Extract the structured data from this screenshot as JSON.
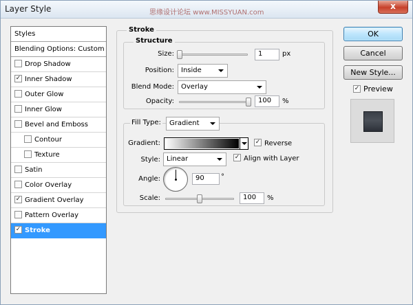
{
  "window": {
    "title": "Layer Style",
    "watermark": "思缘设计论坛 www.MISSYUAN.com",
    "close_glyph": "x"
  },
  "styles_list": {
    "header": "Styles",
    "blending_options": "Blending Options: Custom",
    "items": [
      {
        "label": "Drop Shadow",
        "checked": false,
        "check": ""
      },
      {
        "label": "Inner Shadow",
        "checked": true,
        "check": "✓"
      },
      {
        "label": "Outer Glow",
        "checked": false,
        "check": ""
      },
      {
        "label": "Inner Glow",
        "checked": false,
        "check": ""
      },
      {
        "label": "Bevel and Emboss",
        "checked": false,
        "check": ""
      },
      {
        "label": "Contour",
        "checked": false,
        "check": ""
      },
      {
        "label": "Texture",
        "checked": false,
        "check": ""
      },
      {
        "label": "Satin",
        "checked": false,
        "check": ""
      },
      {
        "label": "Color Overlay",
        "checked": false,
        "check": ""
      },
      {
        "label": "Gradient Overlay",
        "checked": true,
        "check": "✓"
      },
      {
        "label": "Pattern Overlay",
        "checked": false,
        "check": ""
      },
      {
        "label": "Stroke",
        "checked": true,
        "check": "✓",
        "selected": true
      }
    ]
  },
  "stroke": {
    "section_title": "Stroke",
    "structure": {
      "title": "Structure",
      "size_label": "Size:",
      "size_value": "1",
      "size_unit": "px",
      "size_slider_fraction": 0.0,
      "position_label": "Position:",
      "position_value": "Inside",
      "blend_mode_label": "Blend Mode:",
      "blend_mode_value": "Overlay",
      "opacity_label": "Opacity:",
      "opacity_value": "100",
      "opacity_unit": "%",
      "opacity_slider_fraction": 1.0
    },
    "fill": {
      "fill_type_label": "Fill Type:",
      "fill_type_value": "Gradient",
      "gradient_label": "Gradient:",
      "gradient_start_color": "#ffffff",
      "gradient_end_color": "#000000",
      "reverse_label": "Reverse",
      "reverse_checked": true,
      "reverse_check": "✓",
      "style_label": "Style:",
      "style_value": "Linear",
      "align_label": "Align with Layer",
      "align_checked": true,
      "align_check": "✓",
      "angle_label": "Angle:",
      "angle_value": "90",
      "angle_unit": "°",
      "scale_label": "Scale:",
      "scale_value": "100",
      "scale_unit": "%",
      "scale_slider_fraction": 0.5
    }
  },
  "buttons": {
    "ok": "OK",
    "cancel": "Cancel",
    "new_style": "New Style...",
    "preview_label": "Preview",
    "preview_checked": true,
    "preview_check": "✓"
  },
  "colors": {
    "selection": "#3399ff",
    "preview_swatch": "#3a3f47",
    "close_button": "#c7402a"
  }
}
